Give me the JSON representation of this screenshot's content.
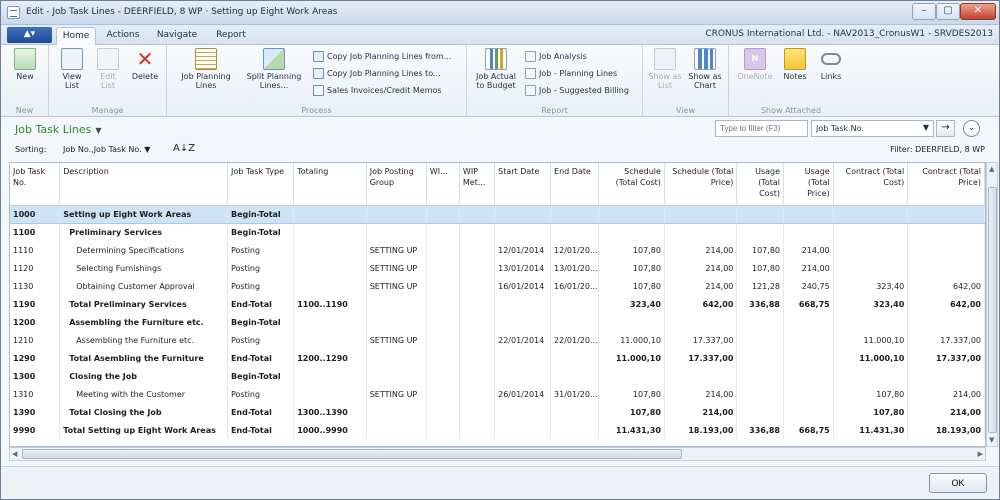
{
  "window": {
    "title": "Edit - Job Task Lines - DEERFIELD, 8 WP · Setting up Eight Work Areas",
    "controls": {
      "minimize": "–",
      "maximize": "▢",
      "close": "✕"
    }
  },
  "tabs": {
    "app_menu_icon": "app-menu-icon",
    "items": [
      {
        "label": "Home"
      },
      {
        "label": "Actions"
      },
      {
        "label": "Navigate"
      },
      {
        "label": "Report"
      }
    ],
    "company": "CRONUS International Ltd. - NAV2013_CronusW1 - SRVDES2013"
  },
  "ribbon": {
    "new": {
      "label": "New",
      "group": "New"
    },
    "manage": {
      "group": "Manage",
      "view_list": "View List",
      "edit_list": "Edit List",
      "delete": "Delete"
    },
    "process": {
      "group": "Process",
      "job_planning_lines": "Job Planning Lines",
      "split_planning_lines": "Split Planning Lines...",
      "copy_from": "Copy Job Planning Lines from...",
      "copy_to": "Copy Job Planning Lines to...",
      "sales_invoices": "Sales Invoices/Credit Memos"
    },
    "report": {
      "group": "Report",
      "job_actual_to_budget": "Job Actual to Budget",
      "job_analysis": "Job Analysis",
      "job_planning_lines": "Job - Planning Lines",
      "job_suggested_billing": "Job - Suggested Billing"
    },
    "view": {
      "group": "View",
      "show_as_list": "Show as List",
      "show_as_chart": "Show as Chart"
    },
    "attached": {
      "group": "Show Attached",
      "onenote": "OneNote",
      "notes": "Notes",
      "links": "Links"
    },
    "colors": {
      "green": "#3c9a3c",
      "red": "#d0342c",
      "blue": "#3a77c4",
      "gold": "#d9a521",
      "purple": "#8a5bb5"
    }
  },
  "page": {
    "title": "Job Task Lines",
    "filter_placeholder": "Type to filter (F3)",
    "filter_field": "Job Task No.",
    "sorting_label": "Sorting:",
    "sorting_value": "Job No.,Job Task No.",
    "sort_direction": "A↓Z",
    "filter_text": "Filter: DEERFIELD, 8 WP"
  },
  "grid": {
    "columns": [
      {
        "key": "no",
        "label": "Job Task No."
      },
      {
        "key": "desc",
        "label": "Description"
      },
      {
        "key": "type",
        "label": "Job Task Type"
      },
      {
        "key": "totaling",
        "label": "Totaling"
      },
      {
        "key": "group",
        "label": "Job Posting Group"
      },
      {
        "key": "wi",
        "label": "WI..."
      },
      {
        "key": "wip",
        "label": "WIP Met..."
      },
      {
        "key": "start",
        "label": "Start Date"
      },
      {
        "key": "end",
        "label": "End Date"
      },
      {
        "key": "sch_cost",
        "label": "Schedule (Total Cost)"
      },
      {
        "key": "sch_price",
        "label": "Schedule (Total Price)"
      },
      {
        "key": "use_cost",
        "label": "Usage (Total Cost)"
      },
      {
        "key": "use_price",
        "label": "Usage (Total Price)"
      },
      {
        "key": "con_cost",
        "label": "Contract (Total Cost)"
      },
      {
        "key": "con_price",
        "label": "Contract (Total Price)"
      }
    ],
    "rows": [
      {
        "no": "1000",
        "desc": "Setting up Eight Work Areas",
        "type": "Begin-Total",
        "totaling": "",
        "group": "",
        "wi": "",
        "wip": "",
        "start": "",
        "end": "",
        "sch_cost": "",
        "sch_price": "",
        "use_cost": "",
        "use_price": "",
        "con_cost": "",
        "con_price": ""
      },
      {
        "no": "1100",
        "desc": "Preliminary Services",
        "type": "Begin-Total",
        "totaling": "",
        "group": "",
        "wi": "",
        "wip": "",
        "start": "",
        "end": "",
        "sch_cost": "",
        "sch_price": "",
        "use_cost": "",
        "use_price": "",
        "con_cost": "",
        "con_price": ""
      },
      {
        "no": "1110",
        "desc": "Determining Specifications",
        "type": "Posting",
        "totaling": "",
        "group": "SETTING UP",
        "wi": "",
        "wip": "",
        "start": "12/01/2014",
        "end": "12/01/20...",
        "sch_cost": "107,80",
        "sch_price": "214,00",
        "use_cost": "107,80",
        "use_price": "214,00",
        "con_cost": "",
        "con_price": ""
      },
      {
        "no": "1120",
        "desc": "Selecting Furnishings",
        "type": "Posting",
        "totaling": "",
        "group": "SETTING UP",
        "wi": "",
        "wip": "",
        "start": "13/01/2014",
        "end": "13/01/20...",
        "sch_cost": "107,80",
        "sch_price": "214,00",
        "use_cost": "107,80",
        "use_price": "214,00",
        "con_cost": "",
        "con_price": ""
      },
      {
        "no": "1130",
        "desc": "Obtaining Customer Approval",
        "type": "Posting",
        "totaling": "",
        "group": "SETTING UP",
        "wi": "",
        "wip": "",
        "start": "16/01/2014",
        "end": "16/01/20...",
        "sch_cost": "107,80",
        "sch_price": "214,00",
        "use_cost": "121,28",
        "use_price": "240,75",
        "con_cost": "323,40",
        "con_price": "642,00"
      },
      {
        "no": "1190",
        "desc": "Total Preliminary Services",
        "type": "End-Total",
        "totaling": "1100..1190",
        "group": "",
        "wi": "",
        "wip": "",
        "start": "",
        "end": "",
        "sch_cost": "323,40",
        "sch_price": "642,00",
        "use_cost": "336,88",
        "use_price": "668,75",
        "con_cost": "323,40",
        "con_price": "642,00"
      },
      {
        "no": "1200",
        "desc": "Assembling the Furniture etc.",
        "type": "Begin-Total",
        "totaling": "",
        "group": "",
        "wi": "",
        "wip": "",
        "start": "",
        "end": "",
        "sch_cost": "",
        "sch_price": "",
        "use_cost": "",
        "use_price": "",
        "con_cost": "",
        "con_price": ""
      },
      {
        "no": "1210",
        "desc": "Assembling the Furniture etc.",
        "type": "Posting",
        "totaling": "",
        "group": "SETTING UP",
        "wi": "",
        "wip": "",
        "start": "22/01/2014",
        "end": "22/01/20...",
        "sch_cost": "11.000,10",
        "sch_price": "17.337,00",
        "use_cost": "",
        "use_price": "",
        "con_cost": "11.000,10",
        "con_price": "17.337,00"
      },
      {
        "no": "1290",
        "desc": "Total Asembling the Furniture",
        "type": "End-Total",
        "totaling": "1200..1290",
        "group": "",
        "wi": "",
        "wip": "",
        "start": "",
        "end": "",
        "sch_cost": "11.000,10",
        "sch_price": "17.337,00",
        "use_cost": "",
        "use_price": "",
        "con_cost": "11.000,10",
        "con_price": "17.337,00"
      },
      {
        "no": "1300",
        "desc": "Closing the Job",
        "type": "Begin-Total",
        "totaling": "",
        "group": "",
        "wi": "",
        "wip": "",
        "start": "",
        "end": "",
        "sch_cost": "",
        "sch_price": "",
        "use_cost": "",
        "use_price": "",
        "con_cost": "",
        "con_price": ""
      },
      {
        "no": "1310",
        "desc": "Meeting with the Customer",
        "type": "Posting",
        "totaling": "",
        "group": "SETTING UP",
        "wi": "",
        "wip": "",
        "start": "26/01/2014",
        "end": "31/01/20...",
        "sch_cost": "107,80",
        "sch_price": "214,00",
        "use_cost": "",
        "use_price": "",
        "con_cost": "107,80",
        "con_price": "214,00"
      },
      {
        "no": "1390",
        "desc": "Total Closing the Job",
        "type": "End-Total",
        "totaling": "1300..1390",
        "group": "",
        "wi": "",
        "wip": "",
        "start": "",
        "end": "",
        "sch_cost": "107,80",
        "sch_price": "214,00",
        "use_cost": "",
        "use_price": "",
        "con_cost": "107,80",
        "con_price": "214,00"
      },
      {
        "no": "9990",
        "desc": "Total Setting up Eight Work Areas",
        "type": "End-Total",
        "totaling": "1000..9990",
        "group": "",
        "wi": "",
        "wip": "",
        "start": "",
        "end": "",
        "sch_cost": "11.431,30",
        "sch_price": "18.193,00",
        "use_cost": "336,88",
        "use_price": "668,75",
        "con_cost": "11.431,30",
        "con_price": "18.193,00"
      }
    ]
  },
  "footer": {
    "ok_label": "OK"
  }
}
